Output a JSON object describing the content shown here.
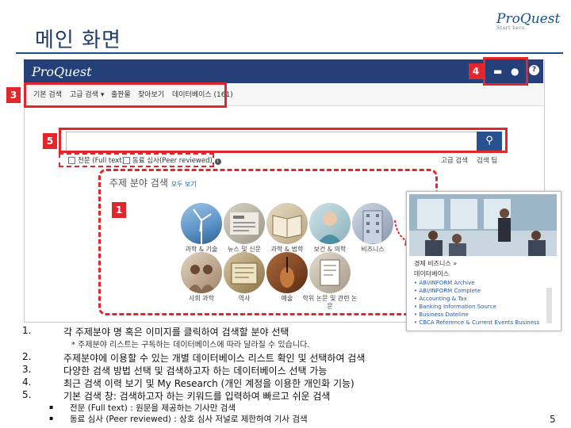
{
  "slide": {
    "title": "메인 화면",
    "logo": "ProQuest",
    "logo_sub": "Start here.",
    "page_number": "5"
  },
  "app": {
    "logo": "ProQuest",
    "nav_items": [
      "기본 검색",
      "고급 검색 ▾",
      "출판물",
      "찾아보기",
      "데이터베이스 (161)"
    ],
    "search": {
      "value": "",
      "placeholder": ""
    },
    "options": [
      "전문 (Full text)",
      "동료 심사(Peer reviewed)"
    ],
    "right_links": [
      "고급 검색",
      "검색 팁"
    ],
    "subject_heading": "주제 분야 검색",
    "subject_heading_link": "모두 보기",
    "subjects": [
      {
        "label": "과학 & 기술"
      },
      {
        "label": "뉴스 및 신문"
      },
      {
        "label": "과학 & 법학"
      },
      {
        "label": "보건 & 의학"
      },
      {
        "label": "비즈니스"
      },
      {
        "label": "사회 과학"
      },
      {
        "label": "역사"
      },
      {
        "label": "예술"
      },
      {
        "label": "학위 논문 및 관련 논문"
      }
    ]
  },
  "popup": {
    "title": "경제 비즈니스 »",
    "db_heading": "데이터베이스",
    "items": [
      "ABI/INFORM Archive",
      "ABI/INFORM Complete",
      "Accounting & Tax",
      "Banking Information Source",
      "Business Dateline",
      "CBCA Reference & Current Events Business"
    ]
  },
  "callouts": [
    "1",
    "2",
    "3",
    "4",
    "5"
  ],
  "notes": [
    {
      "num": "1.",
      "text": "각 주제분야 명 혹은 이미지를 클릭하여 검색할 분야 선택"
    },
    {
      "num": "2.",
      "text": "주제분야에 이용할 수 있는 개별 데이터베이스 리스트 확인 및 선택하여 검색"
    },
    {
      "num": "3.",
      "text": "다양한 검색 방법 선택 및 검색하고자 하는 데이터베이스 선택 가능"
    },
    {
      "num": "4.",
      "text": "최근 검색 이력 보기 및 My Research (개인 계정을 이용한 개인화 기능)"
    },
    {
      "num": "5.",
      "text": "기본 검색 창: 검색하고자 하는 키워드를 입력하여 빠르고 쉬운 검색"
    }
  ],
  "note1_sub": "* 주제분야 리스트는 구독하는 데이터베이스에 따라 달라질 수 있습니다.",
  "bullets": [
    "전문 (Full text) : 원문을 제공하는 기사만 검색",
    "동료 심사 (Peer reviewed) : 상호 심사 저널로 제한하여 기사 검색"
  ],
  "colors": {
    "accent_red": "#e3262c",
    "brand_blue": "#253f78",
    "title_blue": "#1f3b6e"
  }
}
